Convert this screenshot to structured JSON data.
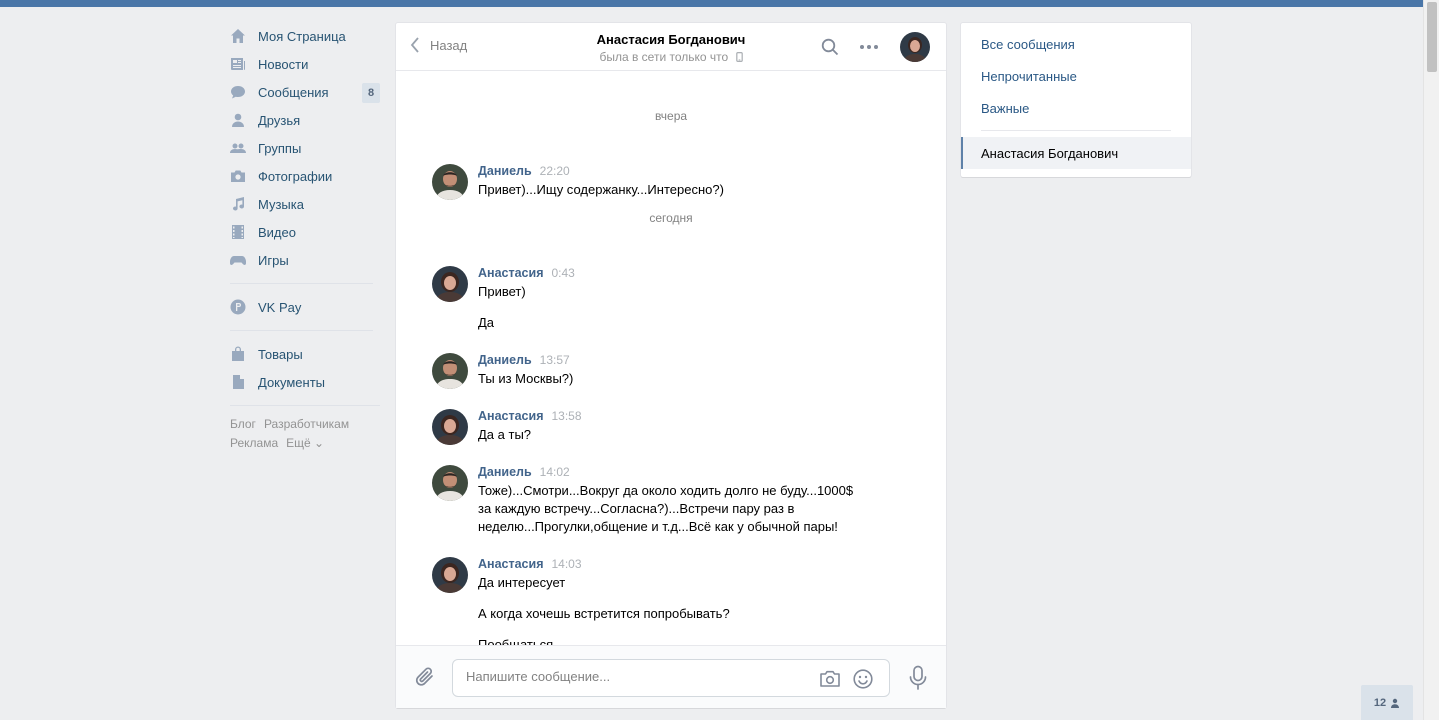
{
  "nav": {
    "items": [
      {
        "label": "Моя Страница",
        "icon": "home-icon"
      },
      {
        "label": "Новости",
        "icon": "news-icon"
      },
      {
        "label": "Сообщения",
        "icon": "messages-icon",
        "badge": "8"
      },
      {
        "label": "Друзья",
        "icon": "friend-icon"
      },
      {
        "label": "Группы",
        "icon": "groups-icon"
      },
      {
        "label": "Фотографии",
        "icon": "camera-icon"
      },
      {
        "label": "Музыка",
        "icon": "music-note-icon"
      },
      {
        "label": "Видео",
        "icon": "film-icon"
      },
      {
        "label": "Игры",
        "icon": "gamepad-icon"
      },
      {
        "label": "VK Pay",
        "icon": "vkpay-icon"
      },
      {
        "label": "Товары",
        "icon": "shopping-bag-icon"
      },
      {
        "label": "Документы",
        "icon": "document-icon"
      }
    ],
    "footer": {
      "blog": "Блог",
      "dev": "Разработчикам",
      "ads": "Реклама",
      "more": "Ещё ⌄"
    }
  },
  "chat": {
    "back_label": "Назад",
    "peer_name": "Анастасия Богданович",
    "peer_status": "была в сети только что",
    "day_yesterday": "вчера",
    "day_today": "сегодня",
    "messages": [
      {
        "author": "Даниель",
        "time": "22:20",
        "text": [
          "Привет)...Ищу содержанку...Интересно?)"
        ]
      },
      {
        "author": "Анастасия",
        "time": "0:43",
        "text": [
          "Привет)",
          "Да"
        ]
      },
      {
        "author": "Даниель",
        "time": "13:57",
        "text": [
          "Ты из Москвы?)"
        ]
      },
      {
        "author": "Анастасия",
        "time": "13:58",
        "text": [
          "Да а ты?"
        ]
      },
      {
        "author": "Даниель",
        "time": "14:02",
        "text": [
          "Тоже)...Смотри...Вокруг да около ходить долго не буду...1000$ за каждую встречу...Согласна?)...Встречи пару раз в неделю...Прогулки,общение и т.д...Всё как у обычной пары!"
        ]
      },
      {
        "author": "Анастасия",
        "time": "14:03",
        "text": [
          "Да интересует",
          "А когда хочешь встретится попробывать?",
          "Пообщаться"
        ]
      }
    ],
    "input_placeholder": "Напишите сообщение..."
  },
  "folders": {
    "all": "Все сообщения",
    "unread": "Непрочитанные",
    "important": "Важные",
    "active_chat": "Анастасия Богданович"
  },
  "online_count": "12",
  "colors": {
    "accent": "#4a76a8",
    "link": "#2a5885",
    "author": "#42648b"
  }
}
